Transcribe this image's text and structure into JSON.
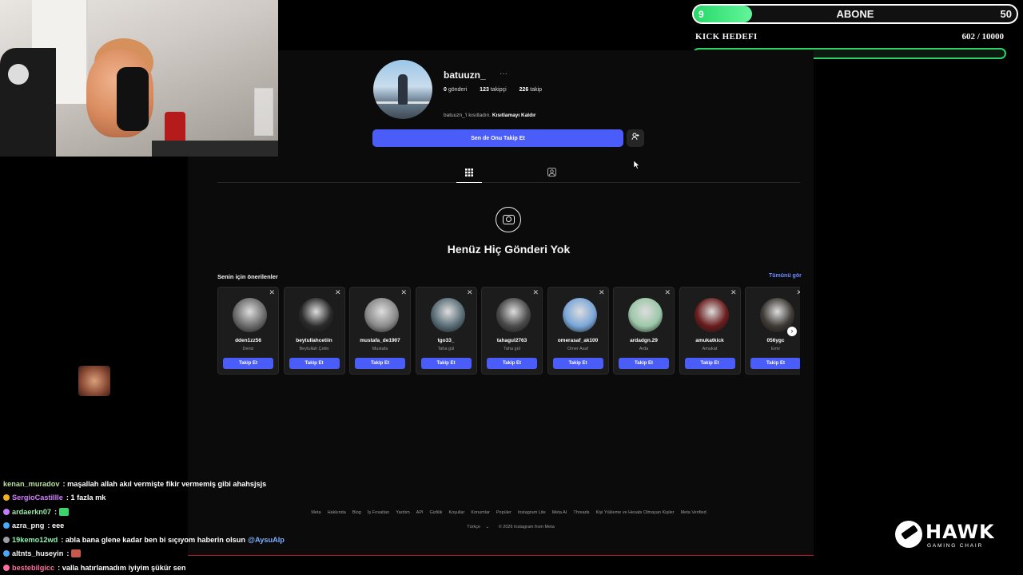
{
  "overlay": {
    "abone": {
      "current": "9",
      "label": "ABONE",
      "max": "50",
      "progress": 0.18
    },
    "kick": {
      "label": "KICK HEDEFI",
      "count": "602 / 10000",
      "progress": 0.0602
    }
  },
  "profile": {
    "username": "batuuzn_",
    "more_label": "···",
    "stats": {
      "posts": "0",
      "posts_label": "gönderi",
      "followers": "123",
      "followers_label": "takipçi",
      "following": "226",
      "following_label": "takip"
    },
    "restrict_text": "batuuzn_'i kısıtladın.",
    "restrict_action": "Kısıtlamayı Kaldır",
    "follow_button": "Sen de Onu Takip Et",
    "add_user_icon": "add-user-icon"
  },
  "tabs": {
    "grid_icon": "grid-icon",
    "tagged_icon": "tagged-icon"
  },
  "empty_state": {
    "title": "Henüz Hiç Gönderi Yok",
    "icon": "camera-icon"
  },
  "suggestions": {
    "title": "Senin için önerilenler",
    "see_all": "Tümünü gör",
    "follow_label": "Takip Et",
    "items": [
      {
        "username": "dden1zz56",
        "name": "Deniz",
        "color": "#6b6b6b"
      },
      {
        "username": "beytullahcetiin",
        "name": "Beytullah Çetin",
        "color": "#2b2b2b"
      },
      {
        "username": "mustafa_de1907",
        "name": "Mustafa",
        "color": "#8a8a8a"
      },
      {
        "username": "tgo33_",
        "name": "Taha gül",
        "color": "#5a6e78"
      },
      {
        "username": "tahagul2763",
        "name": "Taha gül",
        "color": "#4a4a4a"
      },
      {
        "username": "omerasaf_ak100",
        "name": "Ömer Asaf",
        "color": "#7aa6d8"
      },
      {
        "username": "ardadgn.29",
        "name": "Arda",
        "color": "#9cc7a8"
      },
      {
        "username": "amukatkick",
        "name": "Amukat",
        "color": "#6a1d1d"
      },
      {
        "username": "056ygc",
        "name": "Emir",
        "color": "#3e3a35"
      }
    ]
  },
  "footer": {
    "links": [
      "Meta",
      "Hakkında",
      "Blog",
      "İş Fırsatları",
      "Yardım",
      "API",
      "Gizlilik",
      "Koşullar",
      "Konumlar",
      "Popüler",
      "Instagram Lite",
      "Meta AI",
      "Threads",
      "Kişi Yükleme ve Hesabı Olmayan Kişiler",
      "Meta Verified"
    ],
    "language": "Türkçe",
    "copyright": "© 2026 Instagram from Meta"
  },
  "chat": [
    {
      "user": "kenan_muradov",
      "color": "#b8e0a0",
      "badge": "",
      "text": ": maşallah allah akıl vermişte fikir vermemiş gibi ahahsjsjs"
    },
    {
      "user": "SergioCastillle",
      "color": "#d47cff",
      "badge": "#f2b01e",
      "text": ": 1 fazla mk"
    },
    {
      "user": "ardaerkn07",
      "color": "#9ee6a8",
      "badge": "#c47cff",
      "text": ":",
      "emote": "#3bd36a"
    },
    {
      "user": "azra_png",
      "color": "#f5f5f5",
      "badge": "#4aa8ff",
      "text": ": eee"
    },
    {
      "user": "19kemo12wd",
      "color": "#8cf0b0",
      "badge": "#9aa0a6",
      "text": ": abla bana glene kadar ben bi sıçıyom haberin olsun",
      "mention": "@AysuAlp"
    },
    {
      "user": "altnts_huseyin",
      "color": "#f5f5f5",
      "badge": "#4aa8ff",
      "text": ":",
      "emote": "#c65a4a"
    },
    {
      "user": "bestebilgicc",
      "color": "#ff6fa0",
      "badge": "#ff6fa0",
      "text": ": valla hatırlamadım iyiyim şükür sen"
    }
  ],
  "brand": {
    "name": "HAWK",
    "tagline": "GAMING CHAIR"
  }
}
